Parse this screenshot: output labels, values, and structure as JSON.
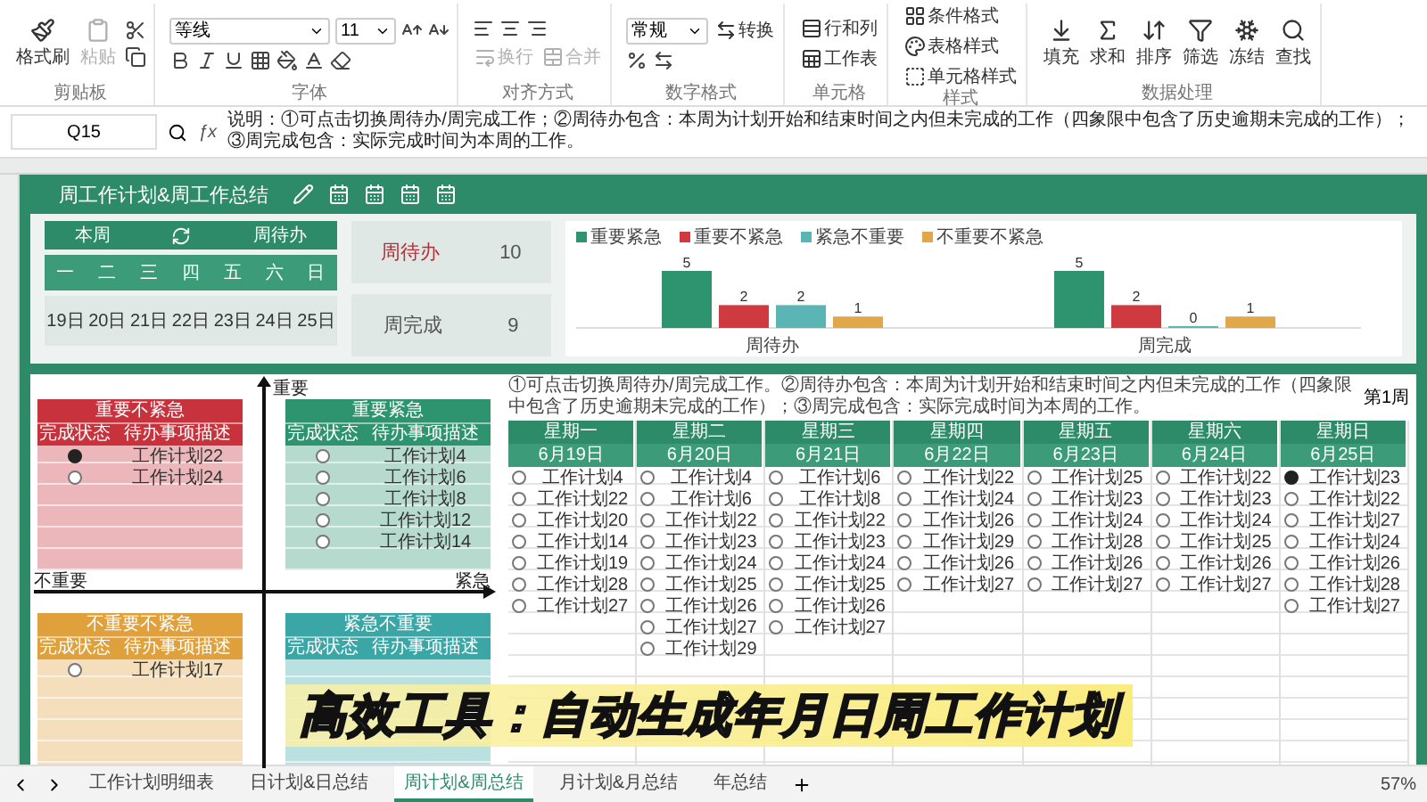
{
  "ribbon": {
    "groups": [
      {
        "kind": "clipboard",
        "label": "剪贴板",
        "tools": [
          {
            "label": "格式刷",
            "disabled": false
          },
          {
            "label": "粘贴",
            "disabled": true
          }
        ]
      },
      {
        "kind": "font",
        "label": "字体",
        "font": "等线",
        "size": "11"
      },
      {
        "kind": "align",
        "label": "对齐方式",
        "tools": [
          {
            "label": "换行",
            "disabled": true
          },
          {
            "label": "合并",
            "disabled": true
          }
        ]
      },
      {
        "kind": "number",
        "label": "数字格式",
        "format": "常规",
        "tools": [
          {
            "label": "转换",
            "disabled": false
          }
        ]
      },
      {
        "kind": "cells",
        "label": "单元格",
        "tools": [
          {
            "label": "行和列",
            "disabled": false
          },
          {
            "label": "工作表",
            "disabled": false
          }
        ]
      },
      {
        "kind": "styles",
        "label": "样式",
        "tools": [
          {
            "label": "条件格式",
            "disabled": false
          },
          {
            "label": "表格样式",
            "disabled": false
          },
          {
            "label": "单元格样式",
            "disabled": false
          }
        ]
      },
      {
        "kind": "data",
        "label": "数据处理",
        "tools": [
          {
            "label": "填充",
            "disabled": false
          },
          {
            "label": "求和",
            "disabled": false
          },
          {
            "label": "排序",
            "disabled": false
          },
          {
            "label": "筛选",
            "disabled": false
          },
          {
            "label": "冻结",
            "disabled": false
          },
          {
            "label": "查找",
            "disabled": false
          }
        ]
      }
    ]
  },
  "formula_bar": {
    "cell": "Q15",
    "fx": "ƒx",
    "formula": "说明：①可点击切换周待办/周完成工作；②周待办包含：本周为计划开始和结束时间之内但未完成的工作（四象限中包含了历史逾期未完成的工作）；③周完成包含：实际完成时间为本周的工作。"
  },
  "sheet": {
    "title": "周工作计划&周工作总结",
    "summary": {
      "toggle_left": "本周",
      "toggle_right": "周待办",
      "weekdays": [
        "一",
        "二",
        "三",
        "四",
        "五",
        "六",
        "日"
      ],
      "dates": [
        "19日",
        "20日",
        "21日",
        "22日",
        "23日",
        "24日",
        "25日"
      ],
      "cards": [
        {
          "label": "周待办",
          "value": "10",
          "highlight": true
        },
        {
          "label": "周完成",
          "value": "9",
          "highlight": false
        }
      ],
      "chart_data": {
        "type": "bar",
        "categories": [
          "周待办",
          "周完成"
        ],
        "data_labels": true,
        "series": [
          {
            "name": "重要紧急",
            "color": "#2e9470",
            "values": [
              5,
              5
            ]
          },
          {
            "name": "重要不紧急",
            "color": "#cf3a40",
            "values": [
              2,
              2
            ]
          },
          {
            "name": "紧急不重要",
            "color": "#5bb5b5",
            "values": [
              2,
              0
            ]
          },
          {
            "name": "不重要不紧急",
            "color": "#e0a848",
            "values": [
              1,
              1
            ]
          }
        ]
      }
    },
    "axes": {
      "top": "重要",
      "left": "不重要",
      "right": "紧急"
    },
    "quadrants": [
      {
        "title": "重要不紧急",
        "color": "#c8323c",
        "columns": [
          "完成状态",
          "待办事项描述"
        ],
        "items": [
          {
            "text": "工作计划22",
            "done": true
          },
          {
            "text": "工作计划24",
            "done": false
          }
        ]
      },
      {
        "title": "重要紧急",
        "color": "#2e9470",
        "columns": [
          "完成状态",
          "待办事项描述"
        ],
        "items": [
          {
            "text": "工作计划4",
            "done": false
          },
          {
            "text": "工作计划6",
            "done": false
          },
          {
            "text": "工作计划8",
            "done": false
          },
          {
            "text": "工作计划12",
            "done": false
          },
          {
            "text": "工作计划14",
            "done": false
          }
        ]
      },
      {
        "title": "不重要不紧急",
        "color": "#e0a03c",
        "columns": [
          "完成状态",
          "待办事项描述"
        ],
        "items": [
          {
            "text": "工作计划17",
            "done": false
          }
        ]
      },
      {
        "title": "紧急不重要",
        "color": "#3aa6a6",
        "columns": [
          "完成状态",
          "待办事项描述"
        ]
      }
    ],
    "week": {
      "note": "①可点击切换周待办/周完成工作。②周待办包含：本周为计划开始和结束时间之内但未完成的工作（四象限中包含了历史逾期未完成的工作）；③周完成包含：实际完成时间为本周的工作。",
      "label": "第1周",
      "days": [
        {
          "name": "星期一",
          "date": "6月19日",
          "items": [
            {
              "text": "工作计划4",
              "done": false
            },
            {
              "text": "工作计划22",
              "done": false
            },
            {
              "text": "工作计划20",
              "done": false
            },
            {
              "text": "工作计划14",
              "done": false
            },
            {
              "text": "工作计划19",
              "done": false
            },
            {
              "text": "工作计划28",
              "done": false
            },
            {
              "text": "工作计划27",
              "done": false
            }
          ]
        },
        {
          "name": "星期二",
          "date": "6月20日",
          "items": [
            {
              "text": "工作计划4",
              "done": false
            },
            {
              "text": "工作计划6",
              "done": false
            },
            {
              "text": "工作计划22",
              "done": false
            },
            {
              "text": "工作计划23",
              "done": false
            },
            {
              "text": "工作计划24",
              "done": false
            },
            {
              "text": "工作计划25",
              "done": false
            },
            {
              "text": "工作计划26",
              "done": false
            },
            {
              "text": "工作计划27",
              "done": false
            },
            {
              "text": "工作计划29",
              "done": false
            }
          ]
        },
        {
          "name": "星期三",
          "date": "6月21日",
          "items": [
            {
              "text": "工作计划6",
              "done": false
            },
            {
              "text": "工作计划8",
              "done": false
            },
            {
              "text": "工作计划22",
              "done": false
            },
            {
              "text": "工作计划23",
              "done": false
            },
            {
              "text": "工作计划24",
              "done": false
            },
            {
              "text": "工作计划25",
              "done": false
            },
            {
              "text": "工作计划26",
              "done": false
            },
            {
              "text": "工作计划27",
              "done": false
            }
          ]
        },
        {
          "name": "星期四",
          "date": "6月22日",
          "items": [
            {
              "text": "工作计划22",
              "done": false
            },
            {
              "text": "工作计划24",
              "done": false
            },
            {
              "text": "工作计划26",
              "done": false
            },
            {
              "text": "工作计划29",
              "done": false
            },
            {
              "text": "工作计划26",
              "done": false
            },
            {
              "text": "工作计划27",
              "done": false
            }
          ]
        },
        {
          "name": "星期五",
          "date": "6月23日",
          "items": [
            {
              "text": "工作计划25",
              "done": false
            },
            {
              "text": "工作计划23",
              "done": false
            },
            {
              "text": "工作计划24",
              "done": false
            },
            {
              "text": "工作计划28",
              "done": false
            },
            {
              "text": "工作计划26",
              "done": false
            },
            {
              "text": "工作计划27",
              "done": false
            }
          ]
        },
        {
          "name": "星期六",
          "date": "6月24日",
          "items": [
            {
              "text": "工作计划22",
              "done": false
            },
            {
              "text": "工作计划23",
              "done": false
            },
            {
              "text": "工作计划24",
              "done": false
            },
            {
              "text": "工作计划25",
              "done": false
            },
            {
              "text": "工作计划26",
              "done": false
            },
            {
              "text": "工作计划27",
              "done": false
            }
          ]
        },
        {
          "name": "星期日",
          "date": "6月25日",
          "items": [
            {
              "text": "工作计划23",
              "done": true
            },
            {
              "text": "工作计划22",
              "done": false
            },
            {
              "text": "工作计划27",
              "done": false
            },
            {
              "text": "工作计划24",
              "done": false
            },
            {
              "text": "工作计划26",
              "done": false
            },
            {
              "text": "工作计划28",
              "done": false
            },
            {
              "text": "工作计划27",
              "done": false
            }
          ]
        }
      ]
    }
  },
  "sheet_tabs": [
    {
      "label": "工作计划明细表",
      "selected": false
    },
    {
      "label": "日计划&日总结",
      "selected": false
    },
    {
      "label": "周计划&周总结",
      "selected": true
    },
    {
      "label": "月计划&月总结",
      "selected": false
    },
    {
      "label": "年总结",
      "selected": false
    }
  ],
  "zoom": "57%",
  "caption": "高效工具：自动生成年月日周工作计划"
}
